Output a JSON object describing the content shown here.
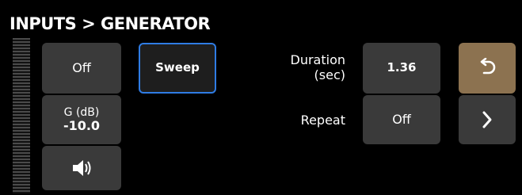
{
  "header": {
    "title": "INPUTS > GENERATOR"
  },
  "generator": {
    "state_button": "Off",
    "mode_button": "Sweep",
    "gain": {
      "label": "G (dB)",
      "value": "-10.0"
    },
    "speaker_icon": "speaker-icon"
  },
  "duration": {
    "label_line1": "Duration",
    "label_line2": "(sec)",
    "value": "1.36"
  },
  "repeat": {
    "label": "Repeat",
    "value": "Off"
  },
  "nav": {
    "undo_icon": "undo-icon",
    "next_icon": "chevron-right-icon"
  },
  "colors": {
    "accent_border": "#2f7ce4",
    "undo_bg": "#8c7250",
    "button_bg": "#3a3a3a"
  }
}
